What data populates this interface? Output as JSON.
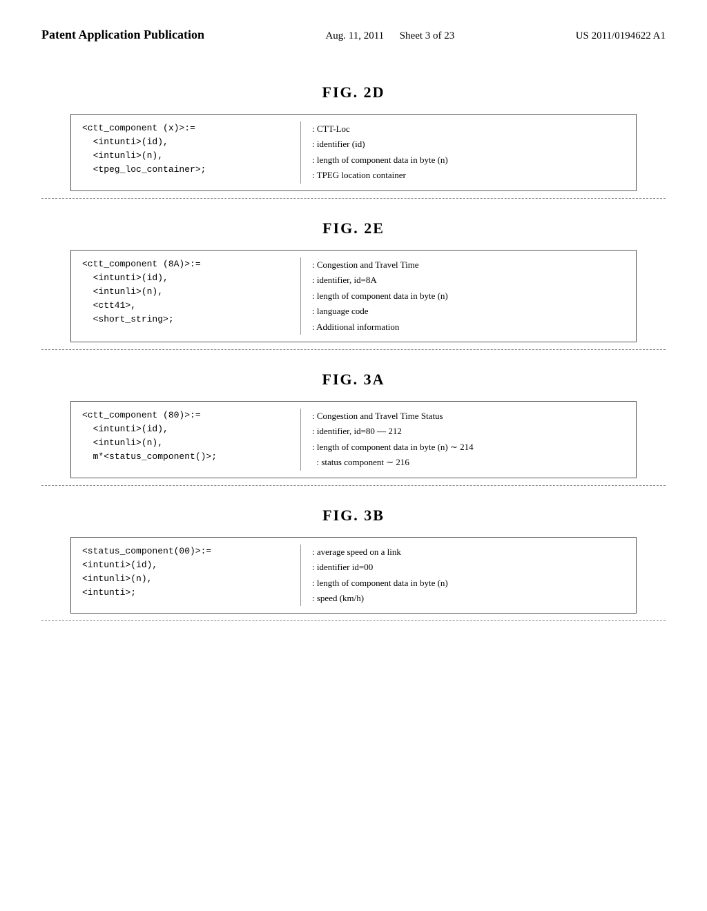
{
  "header": {
    "left_label": "Patent Application Publication",
    "center_label": "Aug. 11, 2011",
    "sheet_label": "Sheet 3 of 23",
    "right_label": "US 2011/0194622 A1"
  },
  "figures": {
    "fig2d": {
      "title": "FIG.  2D",
      "left_lines": "<ctt_component (x)>:=\n  <intunti>(id),\n  <intunli>(n),\n  <tpeg_loc_container>;",
      "right_lines": [
        ": CTT-Loc",
        ": identifier (id)",
        ": length of component data in byte (n)",
        ": TPEG location container"
      ]
    },
    "fig2e": {
      "title": "FIG.  2E",
      "left_lines": "<ctt_component (8A)>:=\n  <intunti>(id),\n  <intunli>(n),\n  <ctt41>,\n  <short_string>;",
      "right_lines": [
        ": Congestion and Travel Time",
        ": identifier, id=8A",
        ": length of component data in byte (n)",
        ": language code",
        ": Additional information"
      ]
    },
    "fig3a": {
      "title": "FIG.  3A",
      "left_lines": "<ctt_component (80)>:=\n  <intunti>(id),\n  <intunli>(n),\n  m*<status_component()>;",
      "right_lines": [
        ": Congestion and Travel Time Status",
        ": identifier, id=80 — 212",
        ": length of component data in byte (n) ∼ 214",
        "  : status component ∼ 216"
      ]
    },
    "fig3b": {
      "title": "FIG.  3B",
      "left_lines": "<status_component(00)>:=\n<intunti>(id),\n<intunli>(n),\n<intunti>;",
      "right_lines": [
        ": average speed on a link",
        ": identifier id=00",
        ": length of component data in byte (n)",
        ": speed (km/h)"
      ]
    }
  }
}
